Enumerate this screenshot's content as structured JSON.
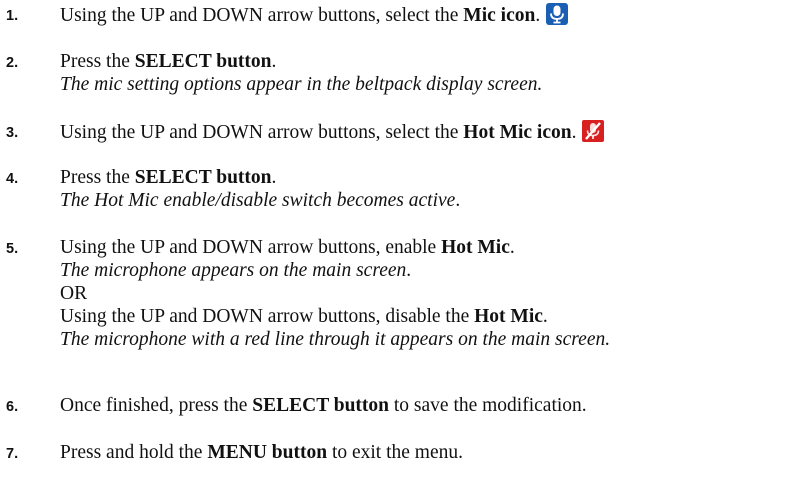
{
  "steps": [
    {
      "number": "1.",
      "parts": [
        "Using the UP and DOWN arrow buttons, select the ",
        "Mic icon",
        "."
      ],
      "icon": "mic-icon"
    },
    {
      "number": "2.",
      "parts": [
        "Press the ",
        "SELECT button",
        "."
      ],
      "note": "The mic setting options appear in the beltpack display screen."
    },
    {
      "number": "3.",
      "parts": [
        "Using the UP and DOWN arrow buttons, select the ",
        "Hot Mic icon",
        "."
      ],
      "icon": "hot-mic-muted-icon"
    },
    {
      "number": "4.",
      "parts": [
        "Press the ",
        "SELECT button",
        "."
      ],
      "note": [
        "The Hot Mic enable/disable switch becomes active",
        "."
      ]
    },
    {
      "number": "5.",
      "parts": [
        "Using the UP and DOWN arrow buttons, enable ",
        "Hot Mic",
        "."
      ],
      "note": [
        "The microphone appears on the main screen",
        "."
      ],
      "or_label": "OR",
      "alt_parts": [
        "Using the UP and DOWN arrow buttons, disable the ",
        "Hot Mic",
        "."
      ],
      "alt_note": "The microphone with a red line through it appears on the main screen."
    },
    {
      "number": "6.",
      "parts": [
        "Once finished, press the ",
        "SELECT button",
        " to save the modification."
      ]
    },
    {
      "number": "7.",
      "parts": [
        "Press and hold the ",
        "MENU button",
        " to exit the menu."
      ]
    }
  ],
  "colors": {
    "mic_icon_bg": "#1a5fb4",
    "mic_icon_fg": "#ffffff",
    "hot_mic_icon_bg": "#d92020",
    "hot_mic_icon_slash": "#ffffff"
  }
}
